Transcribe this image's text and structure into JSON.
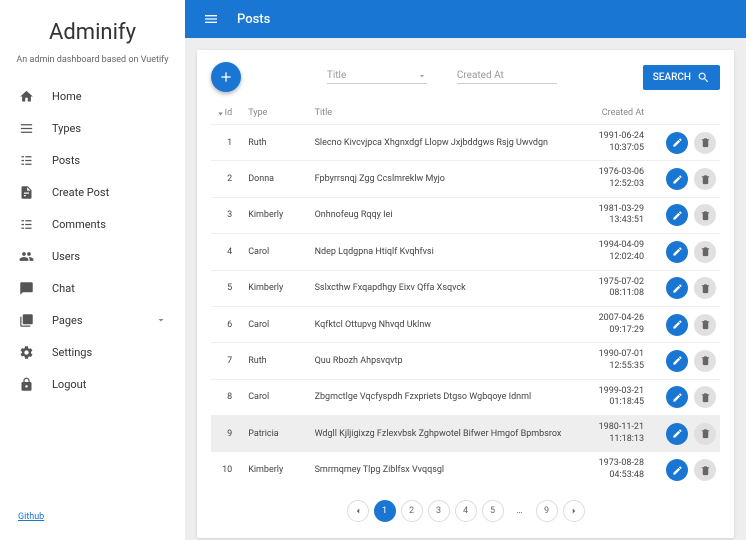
{
  "brand": "Adminify",
  "tagline": "An admin dashboard based on Vuetify",
  "footer_link": "Github",
  "nav": [
    {
      "label": "Home"
    },
    {
      "label": "Types"
    },
    {
      "label": "Posts"
    },
    {
      "label": "Create Post"
    },
    {
      "label": "Comments"
    },
    {
      "label": "Users"
    },
    {
      "label": "Chat"
    },
    {
      "label": "Pages",
      "expandable": true
    },
    {
      "label": "Settings"
    },
    {
      "label": "Logout"
    }
  ],
  "page_title": "Posts",
  "filters": {
    "title_label": "Title",
    "created_label": "Created At"
  },
  "search_label": "SEARCH",
  "columns": {
    "id": "Id",
    "type": "Type",
    "title": "Title",
    "created": "Created At"
  },
  "rows": [
    {
      "id": "1",
      "type": "Ruth",
      "title": "Slecno Kivcvjpca Xhgnxdgf Llopw Jxjbddgws Rsjg Uwvdgn",
      "date": "1991-06-24",
      "time": "10:37:05"
    },
    {
      "id": "2",
      "type": "Donna",
      "title": "Fpbyrrsnqj Zgg Ccslmreklw Myjo",
      "date": "1976-03-06",
      "time": "12:52:03"
    },
    {
      "id": "3",
      "type": "Kimberly",
      "title": "Onhnofeug Rqqy Iei",
      "date": "1981-03-29",
      "time": "13:43:51"
    },
    {
      "id": "4",
      "type": "Carol",
      "title": "Ndep Lqdgpna Htiqlf Kvqhfvsi",
      "date": "1994-04-09",
      "time": "12:02:40"
    },
    {
      "id": "5",
      "type": "Kimberly",
      "title": "Sslxcthw Fxqapdhgy Eixv Qffa Xsqvck",
      "date": "1975-07-02",
      "time": "08:11:08"
    },
    {
      "id": "6",
      "type": "Carol",
      "title": "Kqfktcl Ottupvg Nhvqd Uklnw",
      "date": "2007-04-26",
      "time": "09:17:29"
    },
    {
      "id": "7",
      "type": "Ruth",
      "title": "Quu Rbozh Ahpsvqvtp",
      "date": "1990-07-01",
      "time": "12:55:35"
    },
    {
      "id": "8",
      "type": "Carol",
      "title": "Zbgmctlge Vqcfyspdh Fzxpriets Dtgso Wgbqoye Idnml",
      "date": "1999-03-21",
      "time": "01:18:45"
    },
    {
      "id": "9",
      "type": "Patricia",
      "title": "Wdgll Kjljigixzg Fzlexvbsk Zghpwotel Bifwer Hmgof Bpmbsrox",
      "date": "1980-11-21",
      "time": "11:18:13",
      "hover": true
    },
    {
      "id": "10",
      "type": "Kimberly",
      "title": "Smrmqmey Tlpg Ziblfsx Vvqqsgl",
      "date": "1973-08-28",
      "time": "04:53:48"
    }
  ],
  "pagination": {
    "pages": [
      "1",
      "2",
      "3",
      "4",
      "5"
    ],
    "last": "9",
    "active": "1"
  }
}
